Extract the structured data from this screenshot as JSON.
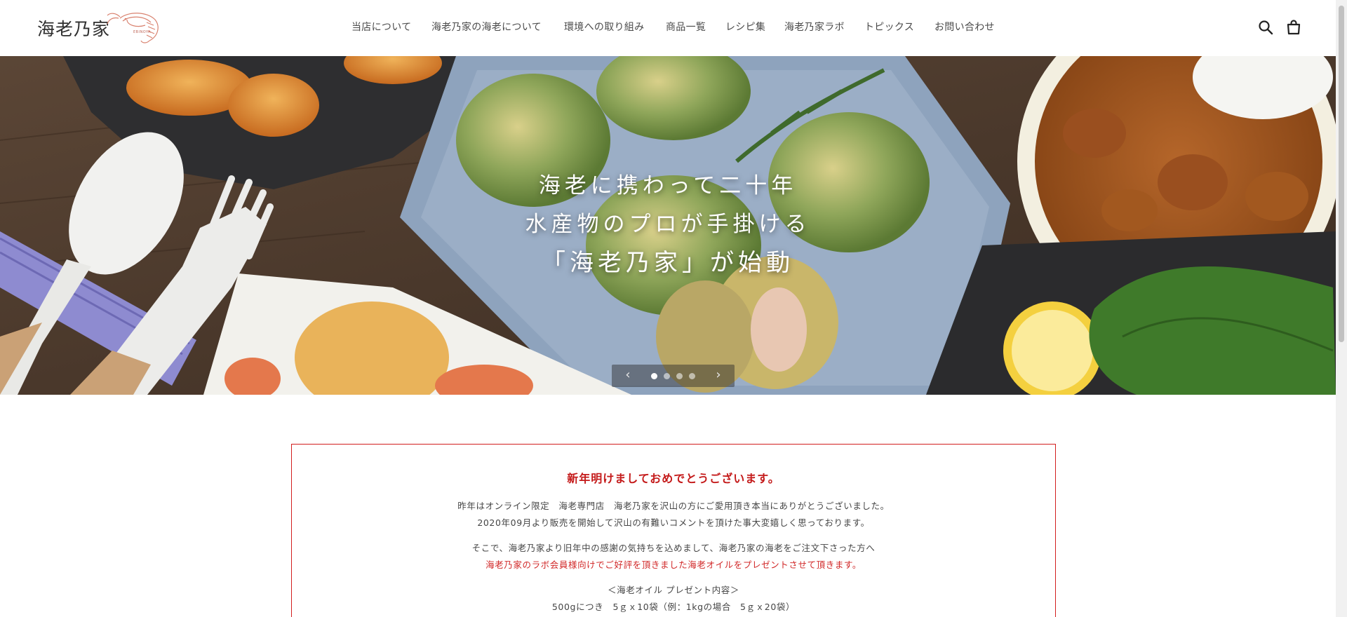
{
  "header": {
    "logo_text": "海老乃家",
    "logo_sub": "EBINOYA",
    "nav": [
      {
        "label": "当店について",
        "name": "nav-about"
      },
      {
        "label": "海老乃家の海老について",
        "name": "nav-shrimp"
      },
      {
        "label": "環境への取り組み",
        "name": "nav-environment"
      },
      {
        "label": "商品一覧",
        "name": "nav-products"
      },
      {
        "label": "レシピ集",
        "name": "nav-recipes"
      },
      {
        "label": "海老乃家ラボ",
        "name": "nav-lab"
      },
      {
        "label": "トピックス",
        "name": "nav-topics"
      },
      {
        "label": "お問い合わせ",
        "name": "nav-contact"
      }
    ],
    "icons": {
      "search": "search-icon",
      "cart": "cart-icon"
    }
  },
  "hero": {
    "line1": "海老に携わって二十年",
    "line2": "水産物のプロが手掛ける",
    "line3": "「海老乃家」が始動",
    "prev": "‹",
    "next": "›",
    "slides": 4,
    "active_slide": 1
  },
  "notice": {
    "title": "新年明けましておめでとうございます。",
    "lines": [
      "昨年はオンライン限定　海老専門店　海老乃家を沢山の方にご愛用頂き本当にありがとうございました。",
      "2020年09月より販売を開始して沢山の有難いコメントを頂けた事大変嬉しく思っております。",
      "そこで、海老乃家より旧年中の感謝の気持ちを込めまして、海老乃家の海老をご注文下さった方へ",
      "海老乃家のラボ会員様向けでご好評を頂きました海老オイルをプレゼントさせて頂きます。",
      "＜海老オイル プレゼント内容＞",
      "500gにつき　5ｇｘ10袋（例：1kgの場合　5ｇｘ20袋）"
    ]
  },
  "colors": {
    "accent_red": "#d21e1e",
    "text": "#3a3a3a"
  }
}
